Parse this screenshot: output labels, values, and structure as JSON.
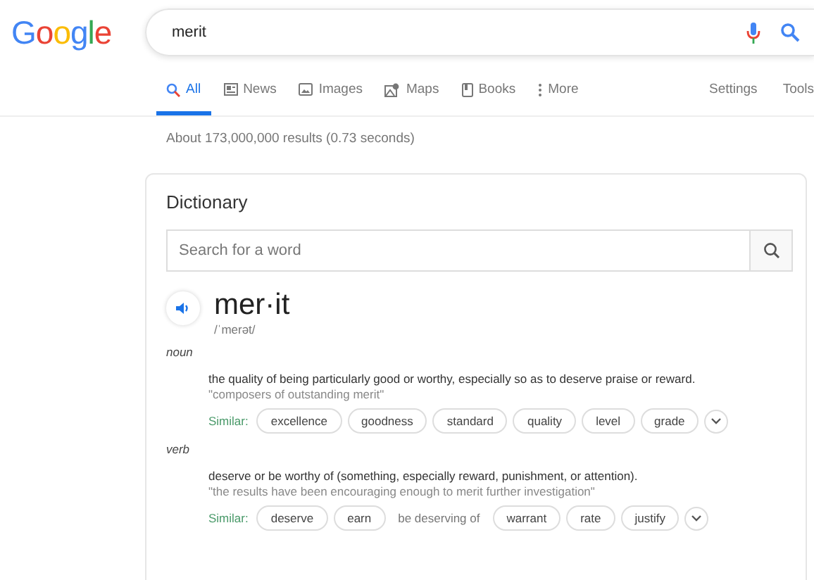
{
  "logo": "Google",
  "search": {
    "value": "merit"
  },
  "tabs": [
    {
      "label": "All",
      "kind": "search",
      "selected": true
    },
    {
      "label": "News",
      "kind": "news",
      "selected": false
    },
    {
      "label": "Images",
      "kind": "image",
      "selected": false
    },
    {
      "label": "Maps",
      "kind": "map",
      "selected": false
    },
    {
      "label": "Books",
      "kind": "book",
      "selected": false
    },
    {
      "label": "More",
      "kind": "menu",
      "selected": false
    }
  ],
  "tools": [
    "Settings",
    "Tools"
  ],
  "result_stats": "About 173,000,000 results (0.73 seconds)",
  "dictionary": {
    "title": "Dictionary",
    "search_placeholder": "Search for a word",
    "word": "mer·it",
    "pronunciation": "/ˈmerət/",
    "senses": [
      {
        "pos": "noun",
        "definition": "the quality of being particularly good or worthy, especially so as to deserve praise or reward.",
        "example": "\"composers of outstanding merit\"",
        "similar_label": "Similar:",
        "similar": [
          {
            "kind": "chip",
            "text": "excellence"
          },
          {
            "kind": "chip",
            "text": "goodness"
          },
          {
            "kind": "chip",
            "text": "standard"
          },
          {
            "kind": "chip",
            "text": "quality"
          },
          {
            "kind": "chip",
            "text": "level"
          },
          {
            "kind": "chip",
            "text": "grade"
          }
        ]
      },
      {
        "pos": "verb",
        "definition": "deserve or be worthy of (something, especially reward, punishment, or attention).",
        "example": "\"the results have been encouraging enough to merit further investigation\"",
        "similar_label": "Similar:",
        "similar": [
          {
            "kind": "chip",
            "text": "deserve"
          },
          {
            "kind": "chip",
            "text": "earn"
          },
          {
            "kind": "plain",
            "text": "be deserving of"
          },
          {
            "kind": "chip",
            "text": "warrant"
          },
          {
            "kind": "chip",
            "text": "rate"
          },
          {
            "kind": "chip",
            "text": "justify"
          }
        ]
      }
    ]
  }
}
